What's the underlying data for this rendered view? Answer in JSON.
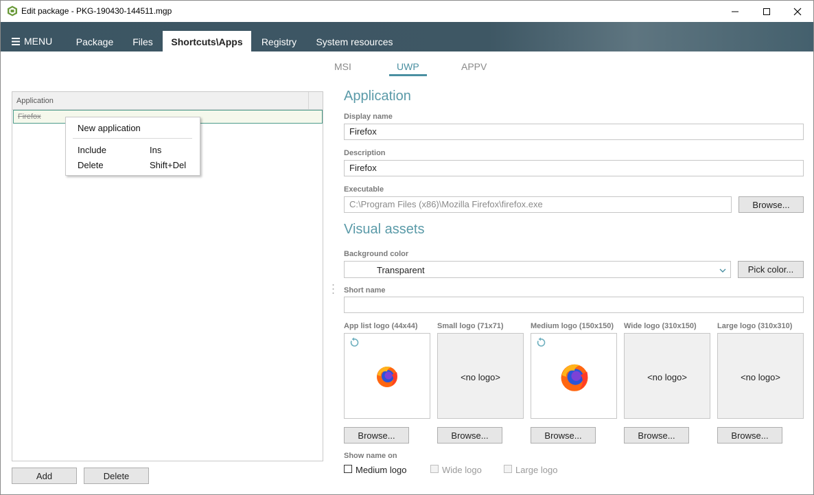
{
  "window": {
    "title": "Edit package - PKG-190430-144511.mgp",
    "controls": [
      "minimize",
      "maximize",
      "close"
    ]
  },
  "nav": {
    "menu_label": "MENU",
    "tabs": [
      {
        "label": "Package",
        "active": false
      },
      {
        "label": "Files",
        "active": false
      },
      {
        "label": "Shortcuts\\Apps",
        "active": true
      },
      {
        "label": "Registry",
        "active": false
      },
      {
        "label": "System resources",
        "active": false
      }
    ]
  },
  "subtabs": [
    {
      "label": "MSI",
      "active": false
    },
    {
      "label": "UWP",
      "active": true
    },
    {
      "label": "APPV",
      "active": false
    }
  ],
  "app_list": {
    "column_header": "Application",
    "rows": [
      {
        "name": "Firefox",
        "excluded": true
      }
    ],
    "add_label": "Add",
    "delete_label": "Delete"
  },
  "context_menu": {
    "items": [
      {
        "label": "New application",
        "shortcut": ""
      },
      {
        "label": "Include",
        "shortcut": "Ins"
      },
      {
        "label": "Delete",
        "shortcut": "Shift+Del"
      }
    ]
  },
  "application": {
    "section_title": "Application",
    "display_name_label": "Display name",
    "display_name_value": "Firefox",
    "description_label": "Description",
    "description_value": "Firefox",
    "executable_label": "Executable",
    "executable_value": "C:\\Program Files (x86)\\Mozilla Firefox\\firefox.exe",
    "browse_label": "Browse..."
  },
  "visual_assets": {
    "section_title": "Visual assets",
    "background_color_label": "Background color",
    "background_color_value": "Transparent",
    "pick_color_label": "Pick color...",
    "short_name_label": "Short name",
    "short_name_value": "",
    "logos": [
      {
        "label": "App list logo (44x44)",
        "has_logo": true,
        "no_logo_text": "",
        "browse_label": "Browse..."
      },
      {
        "label": "Small logo (71x71)",
        "has_logo": false,
        "no_logo_text": "<no logo>",
        "browse_label": "Browse..."
      },
      {
        "label": "Medium logo (150x150)",
        "has_logo": true,
        "no_logo_text": "",
        "browse_label": "Browse..."
      },
      {
        "label": "Wide logo (310x150)",
        "has_logo": false,
        "no_logo_text": "<no logo>",
        "browse_label": "Browse..."
      },
      {
        "label": "Large logo (310x310)",
        "has_logo": false,
        "no_logo_text": "<no logo>",
        "browse_label": "Browse..."
      }
    ],
    "show_name_on_label": "Show name on",
    "show_name_on": [
      {
        "label": "Medium logo",
        "checked": false,
        "enabled": true
      },
      {
        "label": "Wide logo",
        "checked": false,
        "enabled": false
      },
      {
        "label": "Large logo",
        "checked": false,
        "enabled": false
      }
    ]
  },
  "colors": {
    "accent": "#4a8fa1",
    "nav_bar": "#3e5764"
  }
}
